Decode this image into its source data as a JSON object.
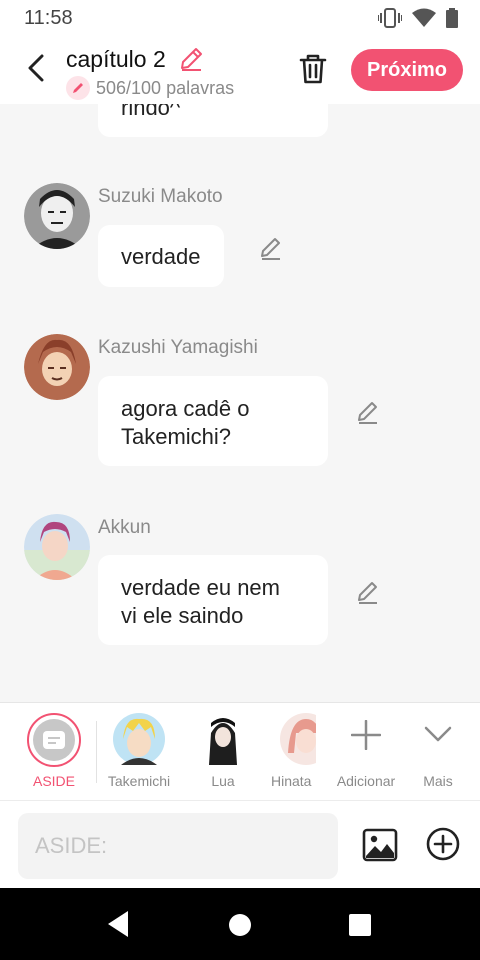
{
  "status": {
    "time": "11:58"
  },
  "header": {
    "title": "capítulo 2",
    "word_count": "506/100 palavras",
    "next_label": "Próximo",
    "accent": "#f25272"
  },
  "chat": {
    "partial_message": "rindo^",
    "messages": [
      {
        "sender": "Suzuki Makoto",
        "text": "verdade"
      },
      {
        "sender": "Kazushi Yamagishi",
        "line1": "agora cadê o",
        "line2": "Takemichi?"
      },
      {
        "sender": "Akkun",
        "line1": "verdade eu nem",
        "line2": "vi ele saindo"
      }
    ]
  },
  "tray": {
    "aside_label": "ASIDE",
    "characters": [
      "Takemichi",
      "Lua",
      "Hinata"
    ],
    "add_label": "Adicionar",
    "more_label": "Mais"
  },
  "composer": {
    "placeholder": "ASIDE:"
  }
}
